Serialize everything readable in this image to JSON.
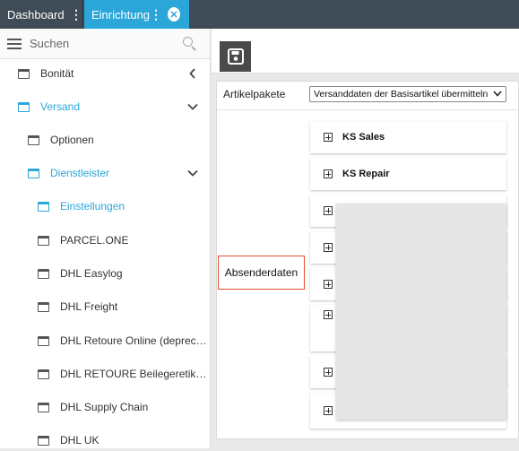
{
  "tabs": [
    {
      "label": "Dashboard",
      "active": false
    },
    {
      "label": "Einrichtung",
      "active": true
    }
  ],
  "colors": {
    "accent": "#2aa7d8",
    "tabbar": "#3f4b57",
    "highlight_border": "#e0522f"
  },
  "sidebar": {
    "search_placeholder": "Suchen",
    "items": [
      {
        "label": "Bonität",
        "icon": "window-icon",
        "chevron": "left"
      },
      {
        "label": "Versand",
        "icon": "window-icon",
        "chevron": "down",
        "active": true
      },
      {
        "label": "Optionen",
        "icon": "window-icon"
      },
      {
        "label": "Dienstleister",
        "icon": "window-icon",
        "chevron": "down",
        "active": true
      },
      {
        "label": "Einstellungen",
        "icon": "window-icon",
        "active": true
      },
      {
        "label": "PARCEL.ONE",
        "icon": "window-icon"
      },
      {
        "label": "DHL Easylog",
        "icon": "window-icon"
      },
      {
        "label": "DHL Freight",
        "icon": "window-icon"
      },
      {
        "label": "DHL Retoure Online (deprecat...",
        "icon": "window-icon"
      },
      {
        "label": "DHL RETOURE Beilegeretikett...",
        "icon": "window-icon"
      },
      {
        "label": "DHL Supply Chain",
        "icon": "window-icon"
      },
      {
        "label": "DHL UK",
        "icon": "window-icon"
      }
    ]
  },
  "toolbar": {
    "save_icon": "floppy-disk-icon"
  },
  "main": {
    "artikelpakete_label": "Artikelpakete",
    "select_value": "Versanddaten der Basisartikel übermitteln",
    "absender_label": "Absenderdaten",
    "packages": [
      {
        "name": "KS Sales"
      },
      {
        "name": "KS Repair"
      },
      {
        "name": ""
      },
      {
        "name": ""
      },
      {
        "name": ""
      },
      {
        "name": ""
      },
      {
        "name": ""
      },
      {
        "name": ""
      }
    ]
  }
}
